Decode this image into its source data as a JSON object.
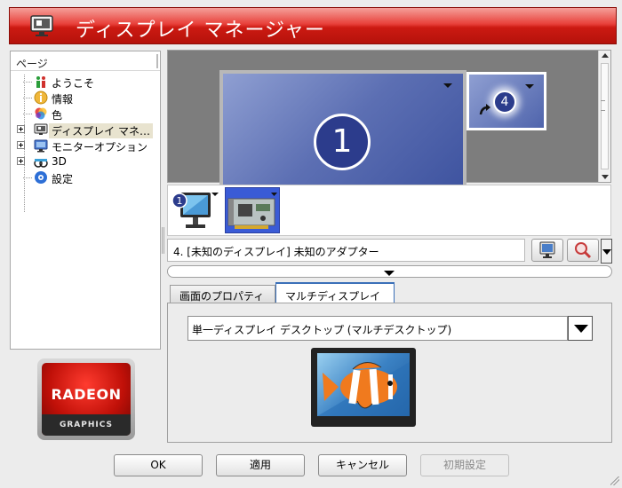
{
  "window": {
    "title": "ディスプレイ マネージャー"
  },
  "tree": {
    "header": "ページ",
    "items": [
      {
        "label": "ようこそ",
        "icon": "welcome-icon"
      },
      {
        "label": "情報",
        "icon": "info-icon"
      },
      {
        "label": "色",
        "icon": "color-icon"
      },
      {
        "label": "ディスプレイ マネ…",
        "icon": "display-manager-icon",
        "selected": true
      },
      {
        "label": "モニターオプション",
        "icon": "monitor-options-icon"
      },
      {
        "label": "3D",
        "icon": "3d-icon"
      },
      {
        "label": "設定",
        "icon": "settings-icon"
      }
    ]
  },
  "logo": {
    "brand": "RADEON",
    "sub": "GRAPHICS"
  },
  "arrangement": {
    "primary_number": "1",
    "secondary_number": "4"
  },
  "device_strip": {
    "monitor_number": "1"
  },
  "selected_device": {
    "text": "4. [未知のディスプレイ] 未知のアダプター"
  },
  "tabs": [
    {
      "label": "画面のプロパティ",
      "active": false
    },
    {
      "label": "マルチディスプレイ",
      "active": true
    }
  ],
  "multi_display": {
    "mode_value": "単一ディスプレイ デスクトップ (マルチデスクトップ)"
  },
  "buttons": {
    "ok": "OK",
    "apply": "適用",
    "cancel": "キャンセル",
    "defaults": "初期設定"
  },
  "colors": {
    "title_red": "#cc1a12",
    "monitor_blue": "#5c6fb3",
    "badge_blue": "#2c3c8c",
    "tab_active_border": "#3a6fb8"
  }
}
